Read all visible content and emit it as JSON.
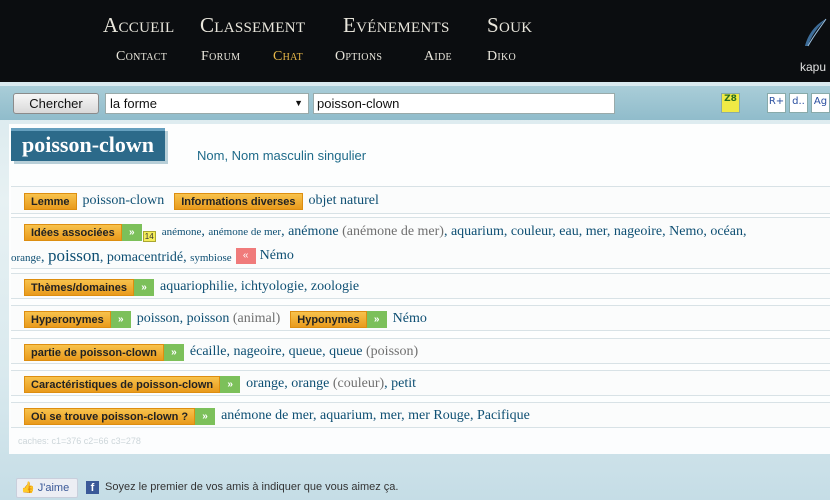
{
  "nav": {
    "row1": [
      "Accueil",
      "Classement",
      "Evénements",
      "Souk"
    ],
    "row2": [
      "Contact",
      "Forum",
      "Chat",
      "Options",
      "Aide",
      "Diko"
    ],
    "active": "Chat",
    "user": "kapu"
  },
  "search": {
    "button_label": "Chercher",
    "mode": "la forme",
    "query": "poisson-clown",
    "tools": [
      "Z8",
      "R+",
      "d..",
      "Ag"
    ]
  },
  "entry": {
    "title": "poisson-clown",
    "pos": "Nom, Nom masculin singulier"
  },
  "relations": {
    "lemme": {
      "label": "Lemme",
      "words": [
        "poisson-clown"
      ]
    },
    "info": {
      "label": "Informations diverses",
      "words": [
        "objet naturel"
      ]
    },
    "idees": {
      "label": "Idées associées",
      "count": "14",
      "line1": [
        {
          "t": "anémone",
          "s": "sm"
        },
        {
          "t": ", "
        },
        {
          "t": "anémone de mer",
          "s": "sm"
        },
        {
          "t": ", "
        },
        {
          "t": "anémone"
        },
        {
          "t": " (anémone de mer)",
          "g": 1
        },
        {
          "t": ", "
        },
        {
          "t": "aquarium"
        },
        {
          "t": ", "
        },
        {
          "t": "couleur"
        },
        {
          "t": ", "
        },
        {
          "t": "eau"
        },
        {
          "t": ", "
        },
        {
          "t": "mer"
        },
        {
          "t": ", "
        },
        {
          "t": "nageoire"
        },
        {
          "t": ", "
        },
        {
          "t": "Nemo"
        },
        {
          "t": ", "
        },
        {
          "t": "océan"
        },
        {
          "t": ","
        }
      ],
      "line2": [
        {
          "t": "orange",
          "s": "sm"
        },
        {
          "t": ", "
        },
        {
          "t": "poisson",
          "s": "lg"
        },
        {
          "t": ", "
        },
        {
          "t": "pomacentridé"
        },
        {
          "t": ", "
        },
        {
          "t": "symbiose",
          "s": "sm"
        }
      ],
      "negative": [
        "Némo"
      ]
    },
    "themes": {
      "label": "Thèmes/domaines",
      "words": [
        "aquariophilie",
        "ichtyologie",
        "zoologie"
      ]
    },
    "hyperonymes": {
      "label": "Hyperonymes",
      "words": [
        "poisson",
        "poisson"
      ],
      "qualifier": "(animal)"
    },
    "hyponymes": {
      "label": "Hyponymes",
      "words": [
        "Némo"
      ]
    },
    "partie": {
      "label": "partie de poisson-clown",
      "words": [
        "écaille",
        "nageoire",
        "queue",
        "queue"
      ],
      "qualifier": "(poisson)"
    },
    "carac": {
      "label": "Caractéristiques de poisson-clown",
      "words": [
        "orange",
        "orange",
        "petit"
      ],
      "qualifier": "(couleur)"
    },
    "ou": {
      "label": "Où se trouve poisson-clown ?",
      "words": [
        "anémone de mer",
        "aquarium",
        "mer",
        "mer Rouge",
        "Pacifique"
      ]
    }
  },
  "caches": "caches: c1=376 c2=66 c3=278",
  "footer": {
    "like_label": "J'aime",
    "fb_text": "Soyez le premier de vos amis à indiquer que vous aimez ça."
  }
}
